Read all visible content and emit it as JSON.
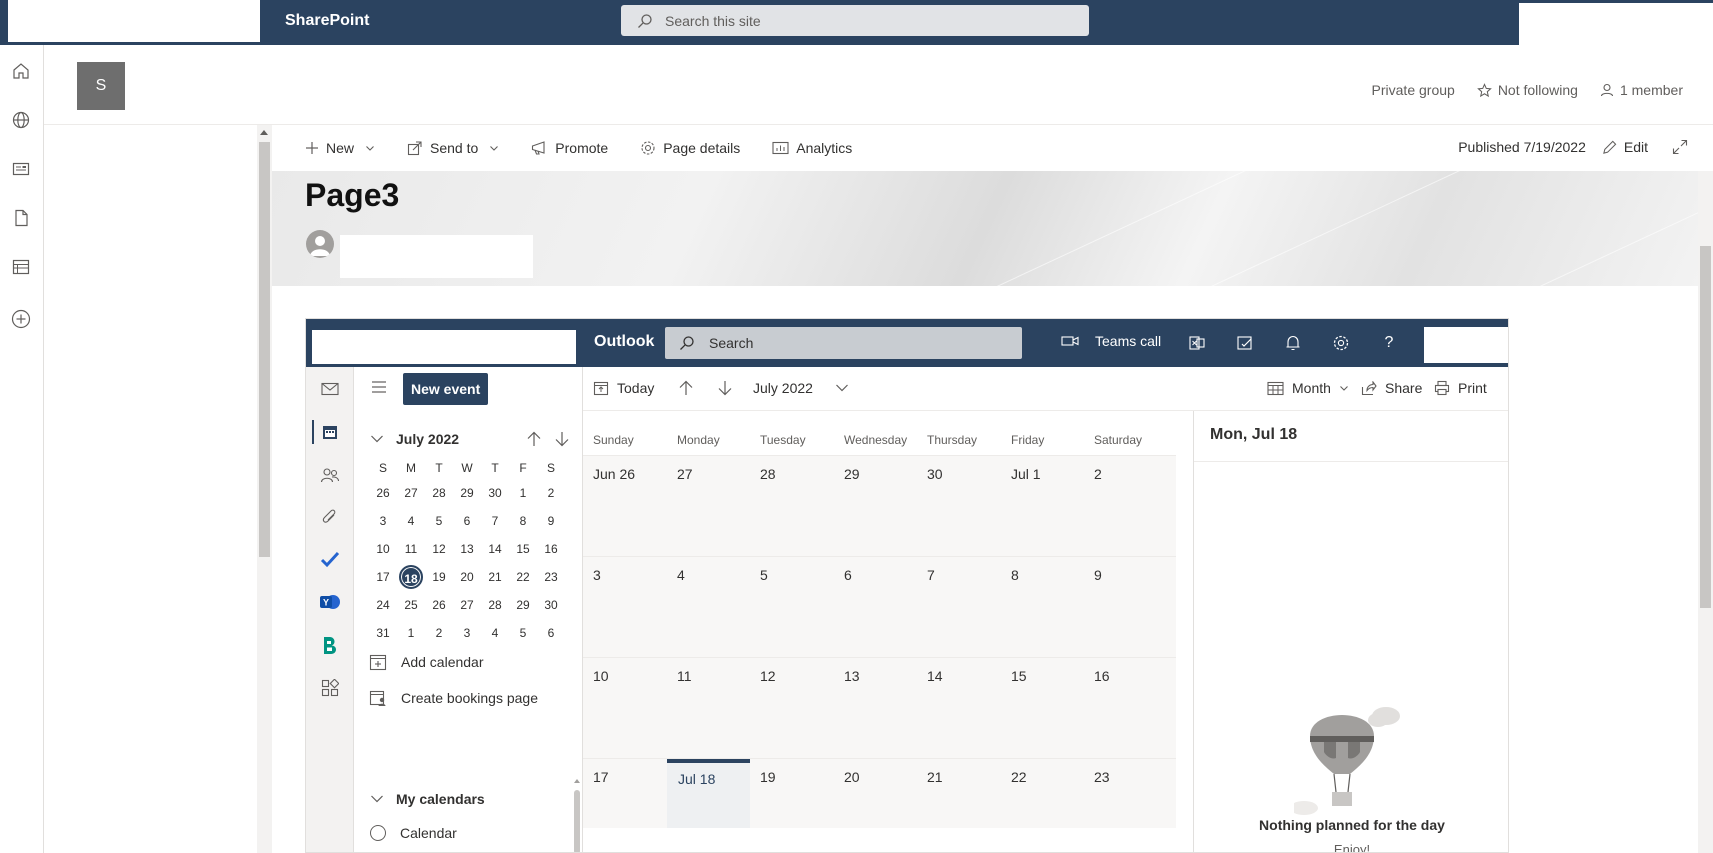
{
  "suitebar": {
    "app_name": "SharePoint",
    "search_placeholder": "Search this site"
  },
  "site": {
    "logo_letter": "S",
    "privacy": "Private group",
    "follow": "Not following",
    "members": "1 member"
  },
  "commandbar": {
    "new": "New",
    "send_to": "Send to",
    "promote": "Promote",
    "page_details": "Page details",
    "analytics": "Analytics",
    "published": "Published 7/19/2022",
    "edit": "Edit"
  },
  "page": {
    "title": "Page3"
  },
  "outlook": {
    "brand": "Outlook",
    "search_placeholder": "Search",
    "teams_call": "Teams call",
    "new_event": "New event",
    "toolbar": {
      "today": "Today",
      "month_label": "July 2022",
      "view": "Month",
      "share": "Share",
      "print": "Print"
    },
    "minical": {
      "title": "July 2022",
      "dow": [
        "S",
        "M",
        "T",
        "W",
        "T",
        "F",
        "S"
      ],
      "weeks": [
        [
          "26",
          "27",
          "28",
          "29",
          "30",
          "1",
          "2"
        ],
        [
          "3",
          "4",
          "5",
          "6",
          "7",
          "8",
          "9"
        ],
        [
          "10",
          "11",
          "12",
          "13",
          "14",
          "15",
          "16"
        ],
        [
          "17",
          "18",
          "19",
          "20",
          "21",
          "22",
          "23"
        ],
        [
          "24",
          "25",
          "26",
          "27",
          "28",
          "29",
          "30"
        ],
        [
          "31",
          "1",
          "2",
          "3",
          "4",
          "5",
          "6"
        ]
      ],
      "today": "18"
    },
    "add_calendar": "Add calendar",
    "create_bookings": "Create bookings page",
    "my_calendars": "My calendars",
    "calendar_item": "Calendar",
    "grid": {
      "days_of_week": [
        "Sunday",
        "Monday",
        "Tuesday",
        "Wednesday",
        "Thursday",
        "Friday",
        "Saturday"
      ],
      "weeks": [
        [
          "Jun 26",
          "27",
          "28",
          "29",
          "30",
          "Jul 1",
          "2"
        ],
        [
          "3",
          "4",
          "5",
          "6",
          "7",
          "8",
          "9"
        ],
        [
          "10",
          "11",
          "12",
          "13",
          "14",
          "15",
          "16"
        ],
        [
          "17",
          "Jul 18",
          "19",
          "20",
          "21",
          "22",
          "23"
        ]
      ]
    },
    "dayview": {
      "heading": "Mon, Jul 18",
      "empty": "Nothing planned for the day",
      "enjoy": "Enjoy!"
    }
  }
}
